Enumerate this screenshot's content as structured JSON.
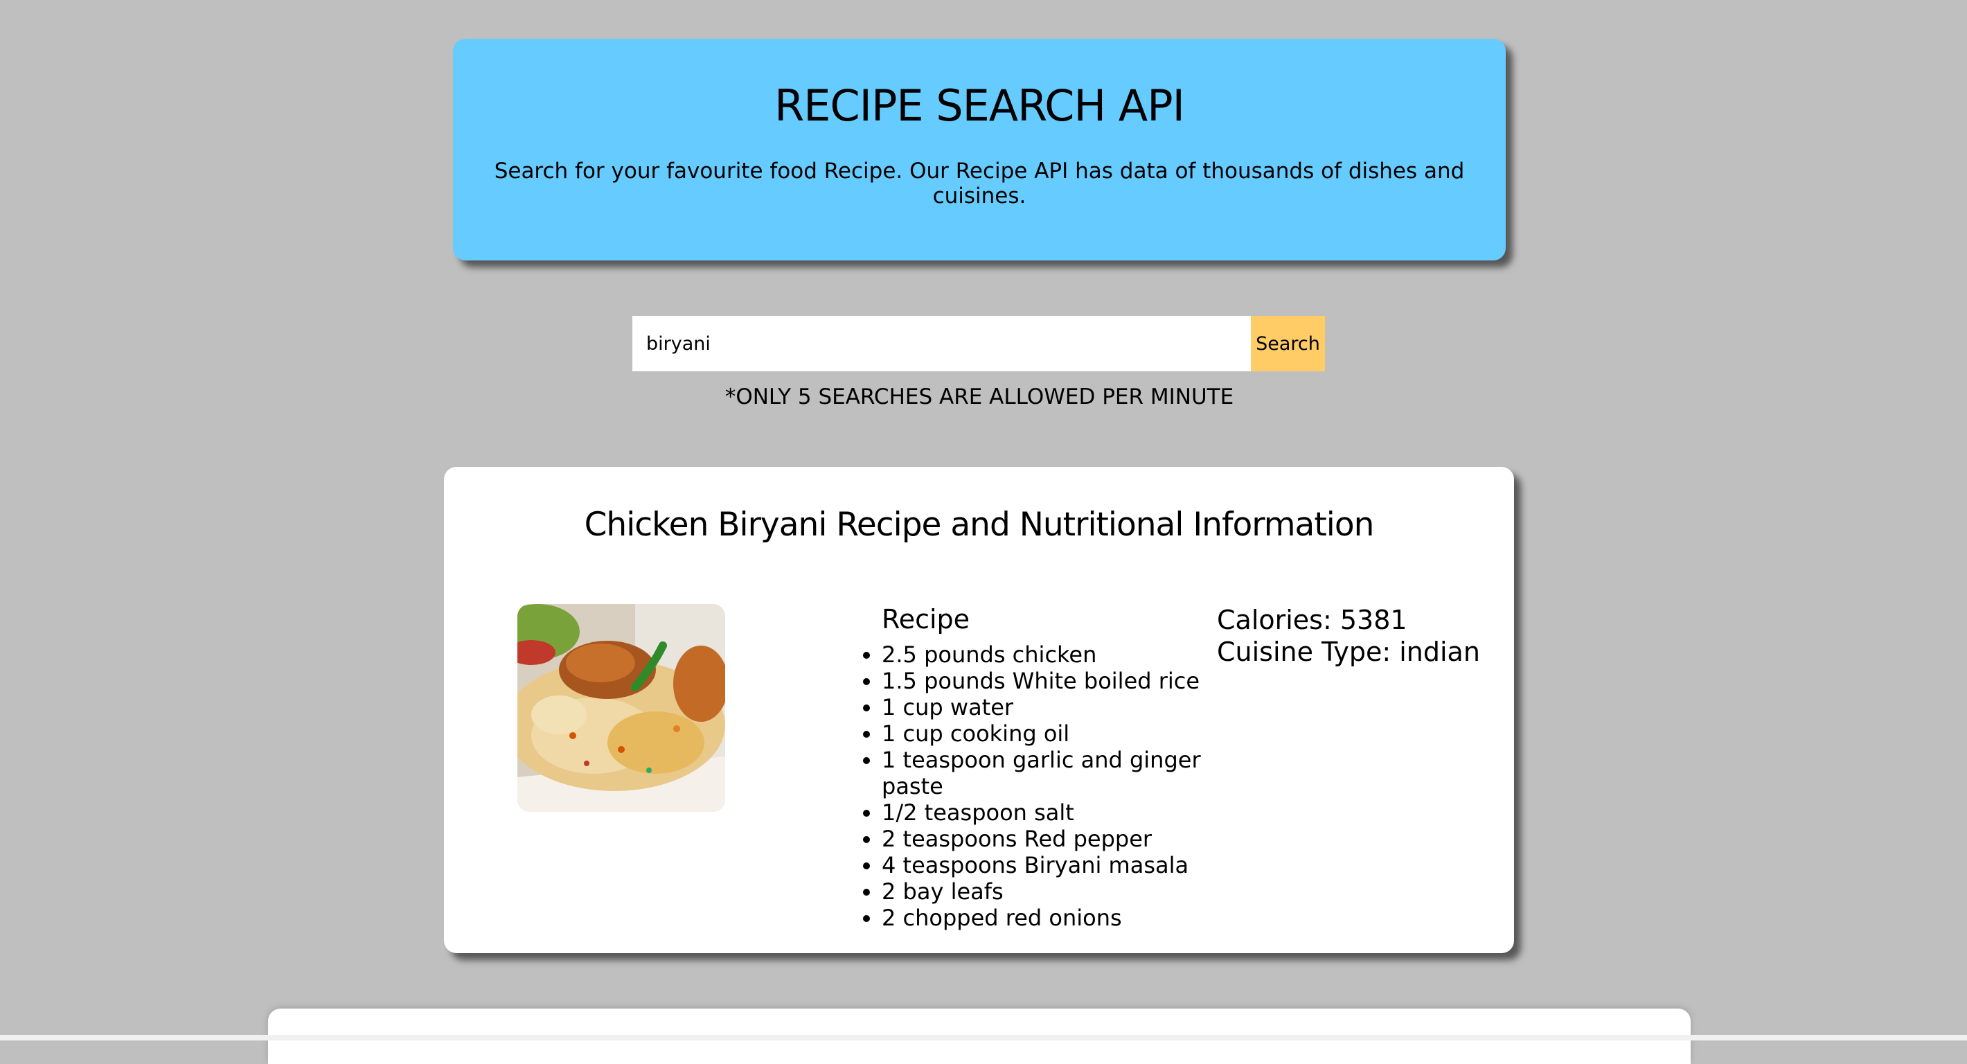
{
  "header": {
    "title": "RECIPE SEARCH API",
    "subtitle": "Search for your favourite food Recipe. Our Recipe API has data of thousands of dishes and cuisines."
  },
  "search": {
    "value": "biryani",
    "placeholder": "",
    "button_label": "Search",
    "limit_note": "*ONLY 5 SEARCHES ARE ALLOWED PER MINUTE"
  },
  "results": [
    {
      "title": "Chicken Biryani Recipe and Nutritional Information",
      "recipe_heading": "Recipe",
      "ingredients": [
        "2.5 pounds chicken",
        "1.5 pounds White boiled rice",
        "1 cup water",
        "1 cup cooking oil",
        "1 teaspoon garlic and ginger paste",
        "1/2 teaspoon salt",
        "2 teaspoons Red pepper",
        "4 teaspoons Biryani masala",
        "2 bay leafs",
        "2 chopped red onions"
      ],
      "calories": "Calories: 5381",
      "cuisine": "Cuisine Type: indian"
    }
  ],
  "colors": {
    "background": "#bfbfbf",
    "header": "#66ccff",
    "search_button": "#ffcc66",
    "card": "#ffffff"
  }
}
